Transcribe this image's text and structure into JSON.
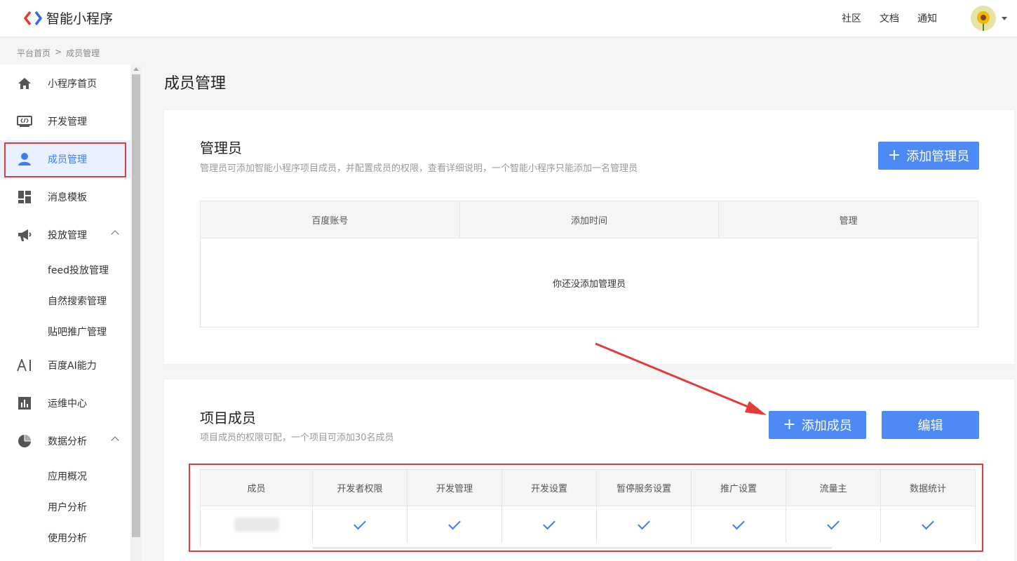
{
  "header": {
    "app_name": "智能小程序",
    "nav": [
      "社区",
      "文档",
      "通知"
    ]
  },
  "breadcrumb": {
    "home": "平台首页",
    "sep": ">",
    "current": "成员管理"
  },
  "sidebar": {
    "items": [
      {
        "label": "小程序首页",
        "icon": "home-icon"
      },
      {
        "label": "开发管理",
        "icon": "code-icon"
      },
      {
        "label": "成员管理",
        "icon": "user-icon",
        "active": true
      },
      {
        "label": "消息模板",
        "icon": "dashboard-icon"
      },
      {
        "label": "投放管理",
        "icon": "megaphone-icon",
        "expanded": true
      },
      {
        "label": "百度AI能力",
        "icon": "ai-icon"
      },
      {
        "label": "运维中心",
        "icon": "bar-chart-icon"
      },
      {
        "label": "数据分析",
        "icon": "pie-chart-icon",
        "expanded": true
      }
    ],
    "sub_items_ads": [
      "feed投放管理",
      "自然搜索管理",
      "贴吧推广管理"
    ],
    "sub_items_data": [
      "应用概况",
      "用户分析",
      "使用分析"
    ]
  },
  "page": {
    "title": "成员管理"
  },
  "admins": {
    "title": "管理员",
    "desc": "管理员可添加智能小程序项目成员，并配置成员的权限，查看详细说明，一个智能小程序只能添加一名管理员",
    "add_button": "添加管理员",
    "columns": [
      "百度账号",
      "添加时间",
      "管理"
    ],
    "empty_text": "你还没添加管理员"
  },
  "members": {
    "title": "项目成员",
    "desc": "项目成员的权限可配，一个项目可添加30名成员",
    "add_button": "添加成员",
    "edit_button": "编辑",
    "columns": [
      "成员",
      "开发者权限",
      "开发管理",
      "开发设置",
      "暂停服务设置",
      "推广设置",
      "流量主",
      "数据统计"
    ],
    "rows": [
      {
        "name": "",
        "permissions": [
          true,
          true,
          true,
          true,
          true,
          true,
          true
        ]
      }
    ]
  },
  "colors": {
    "accent": "#4e8af6",
    "active_text": "#3c7cf5",
    "annotation_red": "#e63a3a"
  }
}
